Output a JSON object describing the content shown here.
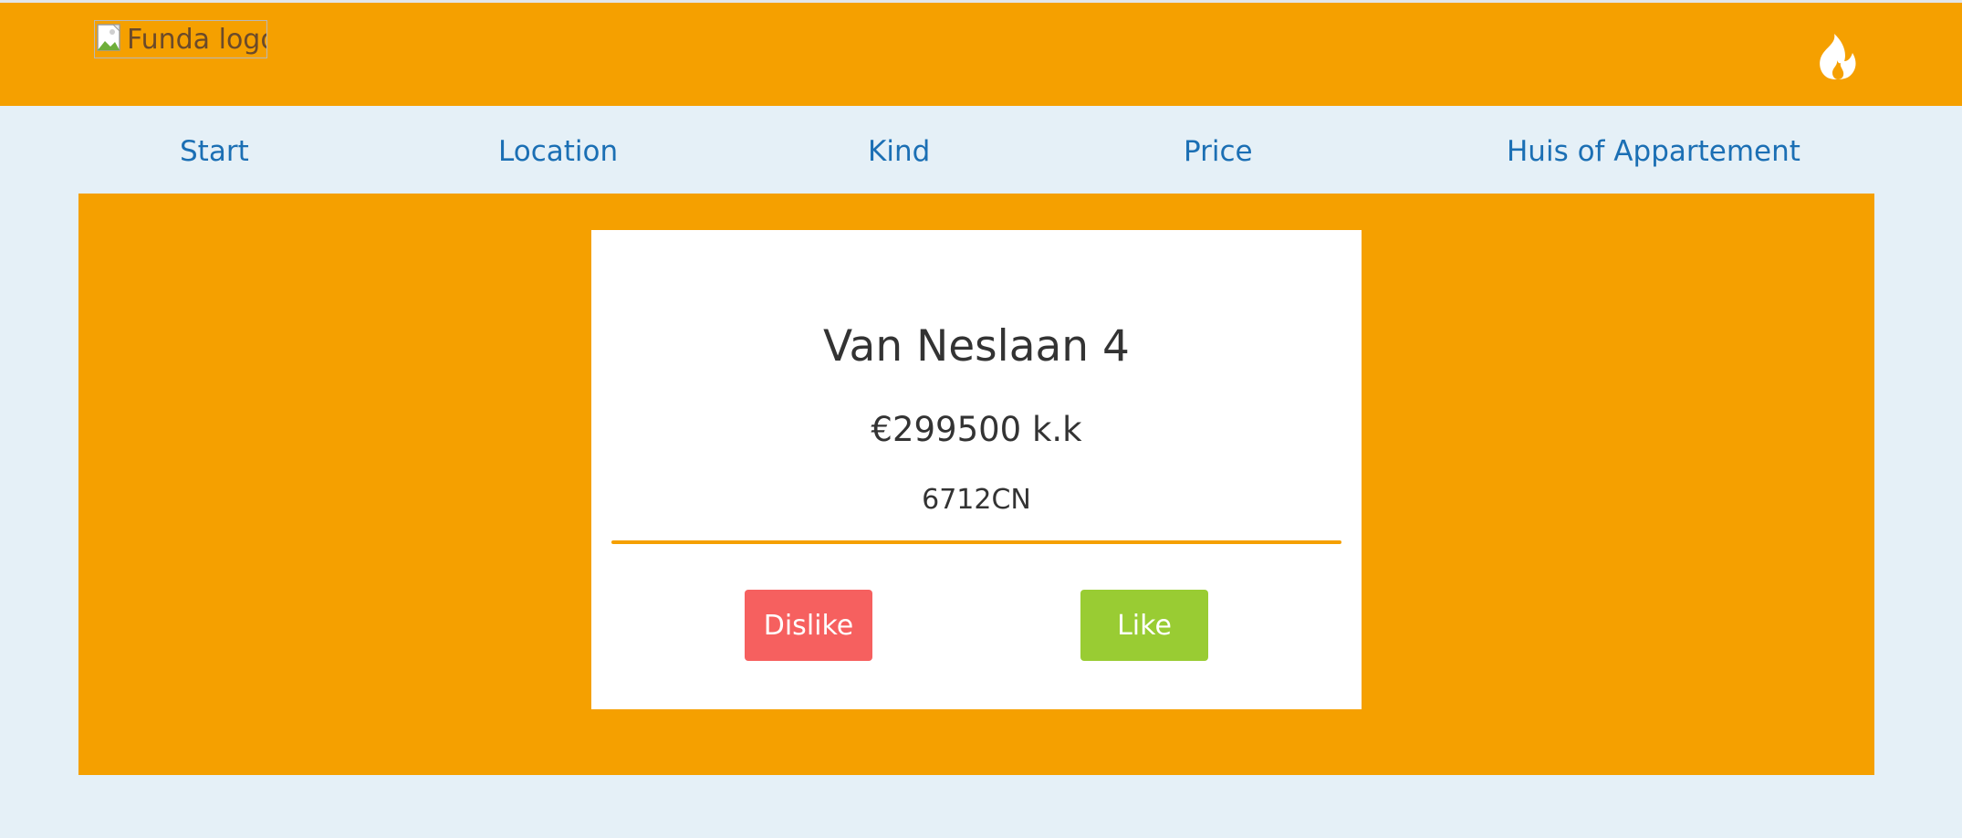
{
  "header": {
    "logo_alt": "Funda logo",
    "right_icon": "flame-icon",
    "background": "#f5a000"
  },
  "nav": {
    "items": [
      {
        "label": "Start"
      },
      {
        "label": "Location"
      },
      {
        "label": "Kind"
      },
      {
        "label": "Price"
      },
      {
        "label": "Huis of Appartement"
      }
    ],
    "color": "#1b6fb4"
  },
  "listing": {
    "address": "Van Neslaan 4",
    "price": "€299500 k.k",
    "postcode": "6712CN"
  },
  "actions": {
    "dislike_label": "Dislike",
    "like_label": "Like",
    "dislike_color": "#f6605f",
    "like_color": "#99cc33"
  }
}
